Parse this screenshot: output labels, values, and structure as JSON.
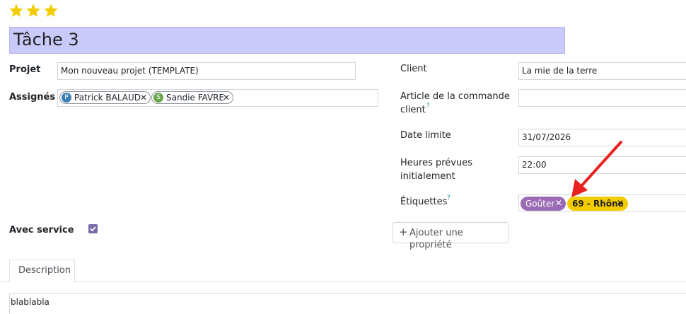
{
  "priority": {
    "stars": 3,
    "star_color": "#f3cc00"
  },
  "task": {
    "title": "Tâche 3"
  },
  "left_fields": {
    "project_label": "Projet",
    "project_value": "Mon nouveau projet (TEMPLATE)",
    "assignees_label": "Assignés",
    "assignees": [
      {
        "initial": "P",
        "name": "Patrick BALAUD",
        "color": "#3d7fb5"
      },
      {
        "initial": "S",
        "name": "Sandie FAVRE",
        "color": "#6aa84f"
      }
    ],
    "service_label": "Avec service",
    "service_checked": true
  },
  "right_fields": {
    "client_label": "Client",
    "client_value": "La mie de la terre",
    "order_line_label_1": "Article de la commande",
    "order_line_label_2": "client",
    "order_line_help": "?",
    "order_line_value": "",
    "deadline_label": "Date limite",
    "deadline_value": "31/07/2026",
    "planned_label_1": "Heures prévues",
    "planned_label_2": "initialement",
    "planned_value": "22:00",
    "tags_label": "Étiquettes",
    "tags_help": "?",
    "tags": [
      {
        "name": "Goûter",
        "bg": "#9b6bb5",
        "fg": "#ffffff"
      },
      {
        "name": "69 - Rhône",
        "bg": "#f3cc00",
        "fg": "#222222"
      }
    ],
    "tag_remove_glyph": "✕"
  },
  "add_property": {
    "icon": "plus-icon",
    "label": "Ajouter une propriété"
  },
  "tabs": [
    {
      "label": "Description"
    }
  ],
  "description": {
    "text": "blablabla"
  },
  "annotation": {
    "color": "#e8231f"
  }
}
